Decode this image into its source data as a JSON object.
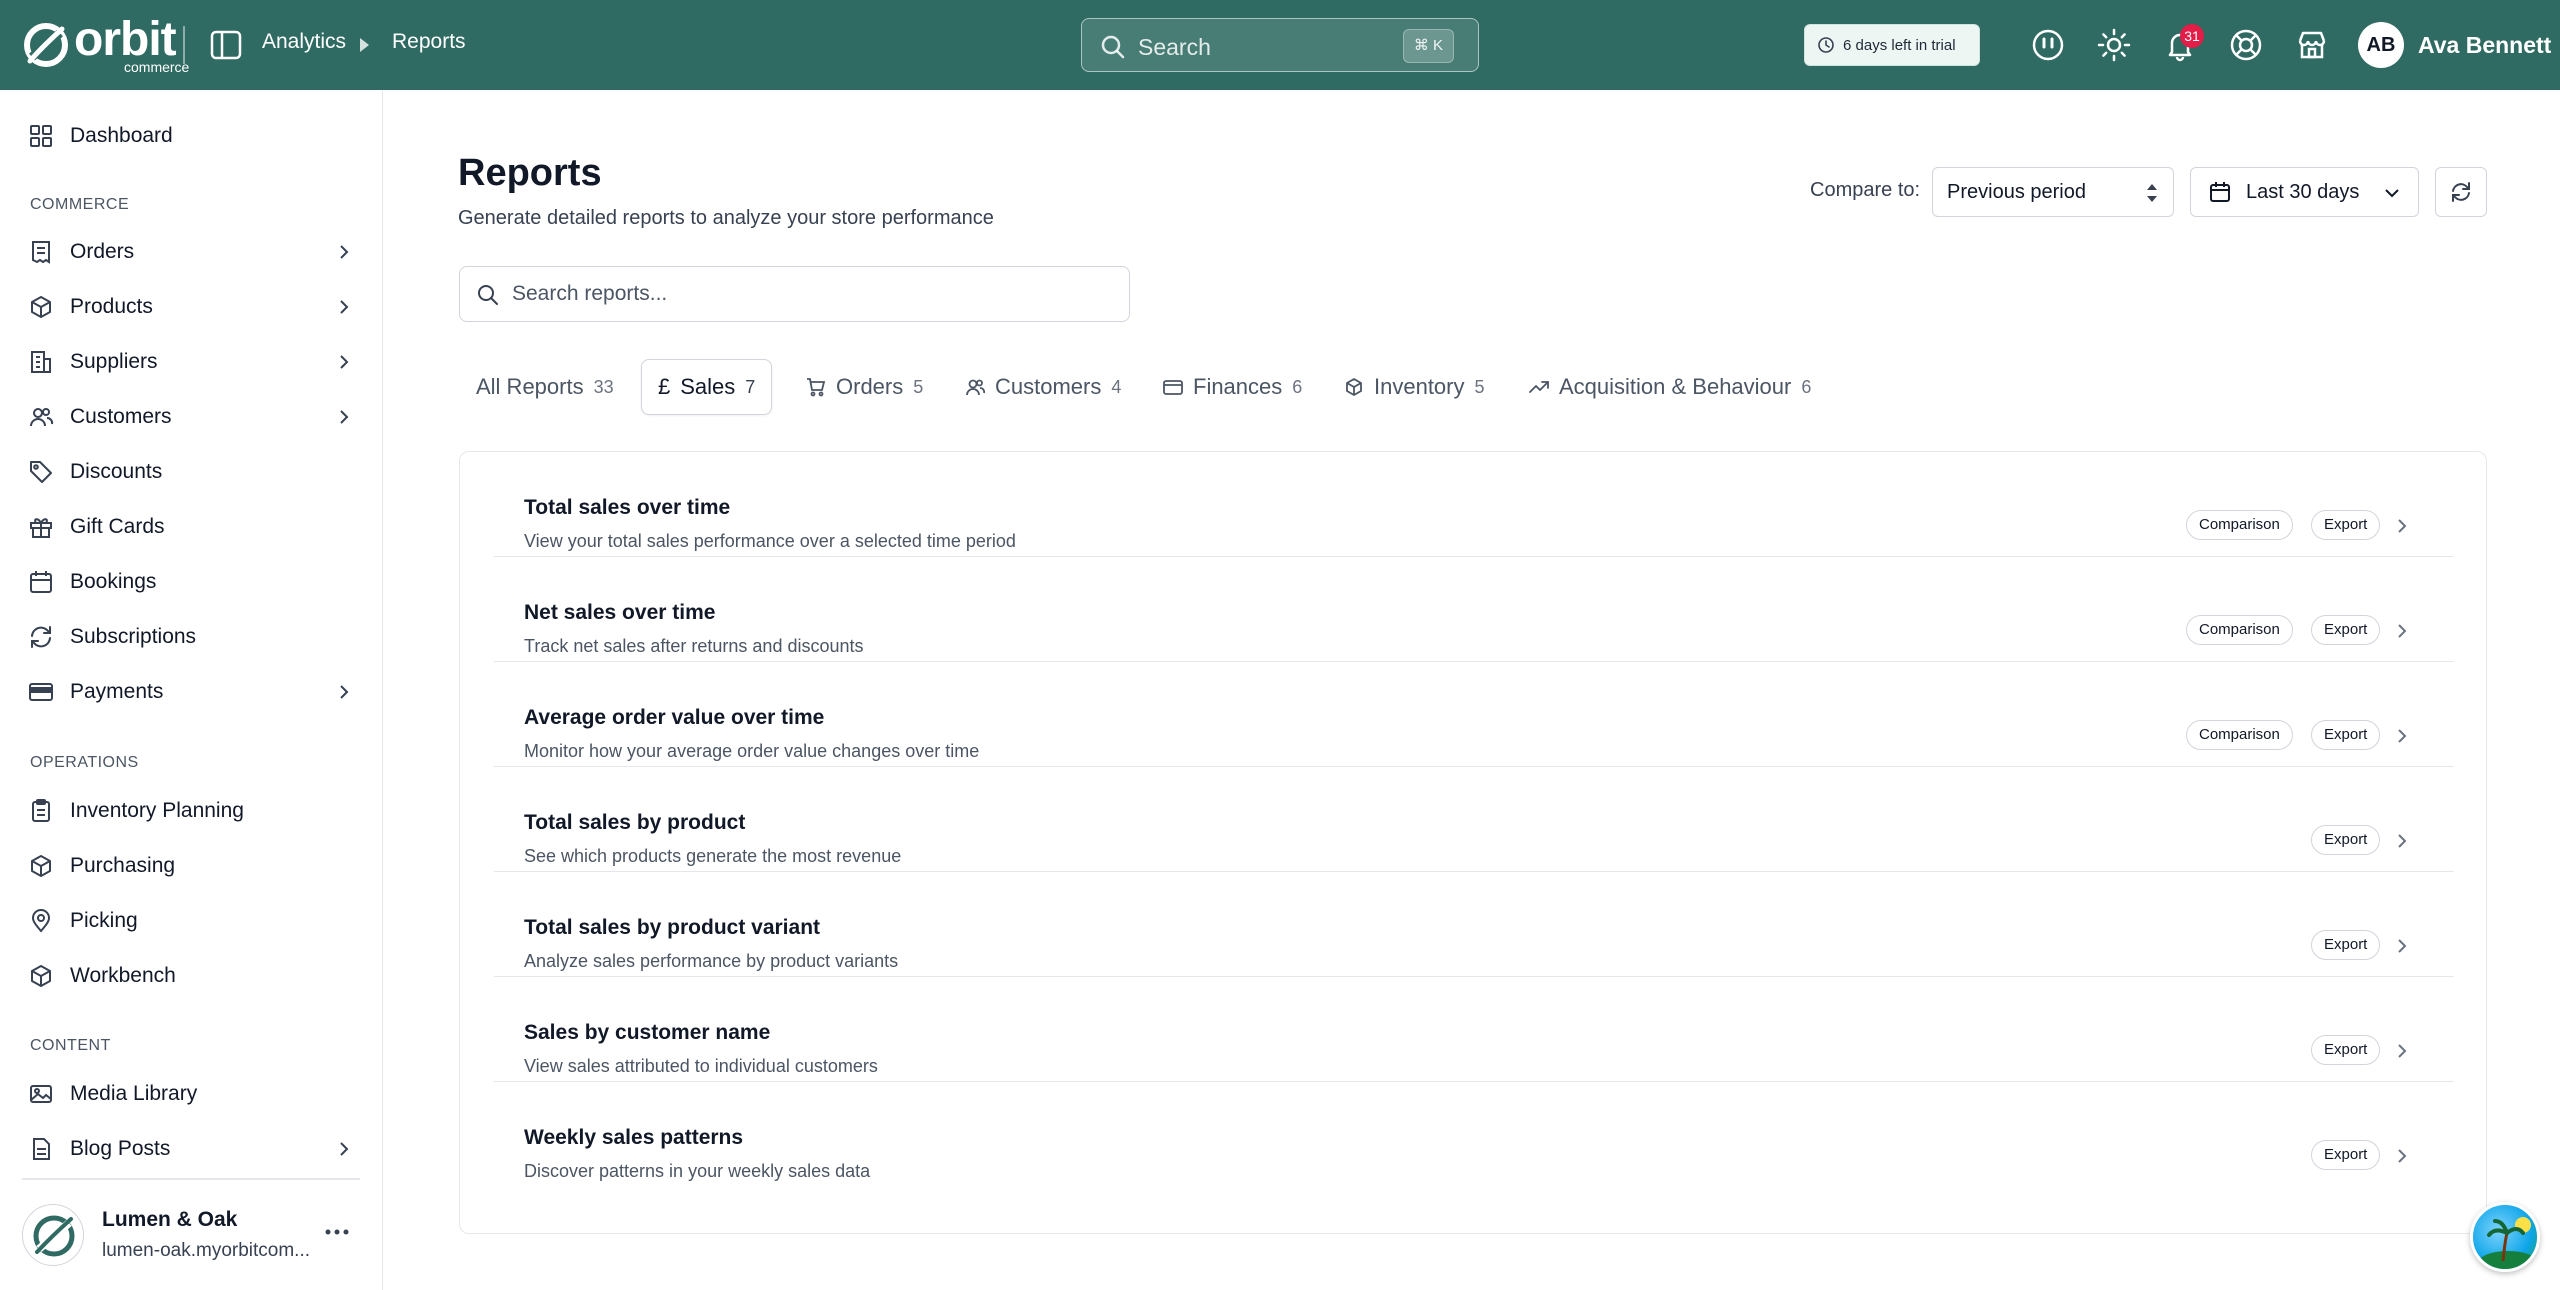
{
  "header": {
    "logo_word": "orbit",
    "logo_sub": "commerce",
    "breadcrumb": [
      "Analytics",
      "Reports"
    ],
    "search_placeholder": "Search",
    "search_shortcut": "⌘ K",
    "trial_text": "6 days left in trial",
    "notification_count": "31",
    "user_initials": "AB",
    "user_name": "Ava Bennett"
  },
  "sidebar": {
    "top_item": "Dashboard",
    "sections": [
      {
        "title": "COMMERCE",
        "items": [
          "Orders",
          "Products",
          "Suppliers",
          "Customers",
          "Discounts",
          "Gift Cards",
          "Bookings",
          "Subscriptions",
          "Payments"
        ]
      },
      {
        "title": "OPERATIONS",
        "items": [
          "Inventory Planning",
          "Purchasing",
          "Picking",
          "Workbench"
        ]
      },
      {
        "title": "CONTENT",
        "items": [
          "Media Library",
          "Blog Posts"
        ]
      }
    ],
    "store_name": "Lumen & Oak",
    "store_url": "lumen-oak.myorbitcom..."
  },
  "main": {
    "title": "Reports",
    "subtitle": "Generate detailed reports to analyze your store performance",
    "compare_label": "Compare to:",
    "compare_value": "Previous period",
    "date_range": "Last 30 days",
    "search_placeholder": "Search reports..."
  },
  "tabs": [
    {
      "label": "All Reports",
      "count": "33"
    },
    {
      "label": "Sales",
      "count": "7"
    },
    {
      "label": "Orders",
      "count": "5"
    },
    {
      "label": "Customers",
      "count": "4"
    },
    {
      "label": "Finances",
      "count": "6"
    },
    {
      "label": "Inventory",
      "count": "5"
    },
    {
      "label": "Acquisition & Behaviour",
      "count": "6"
    }
  ],
  "pill_labels": {
    "comparison": "Comparison",
    "export": "Export"
  },
  "reports": [
    {
      "title": "Total sales over time",
      "desc": "View your total sales performance over a selected time period"
    },
    {
      "title": "Net sales over time",
      "desc": "Track net sales after returns and discounts"
    },
    {
      "title": "Average order value over time",
      "desc": "Monitor how your average order value changes over time"
    },
    {
      "title": "Total sales by product",
      "desc": "See which products generate the most revenue"
    },
    {
      "title": "Total sales by product variant",
      "desc": "Analyze sales performance by product variants"
    },
    {
      "title": "Sales by customer name",
      "desc": "View sales attributed to individual customers"
    },
    {
      "title": "Weekly sales patterns",
      "desc": "Discover patterns in your weekly sales data"
    }
  ],
  "colors": {
    "header_bg": "#2f6b62",
    "badge": "#e11d48"
  }
}
